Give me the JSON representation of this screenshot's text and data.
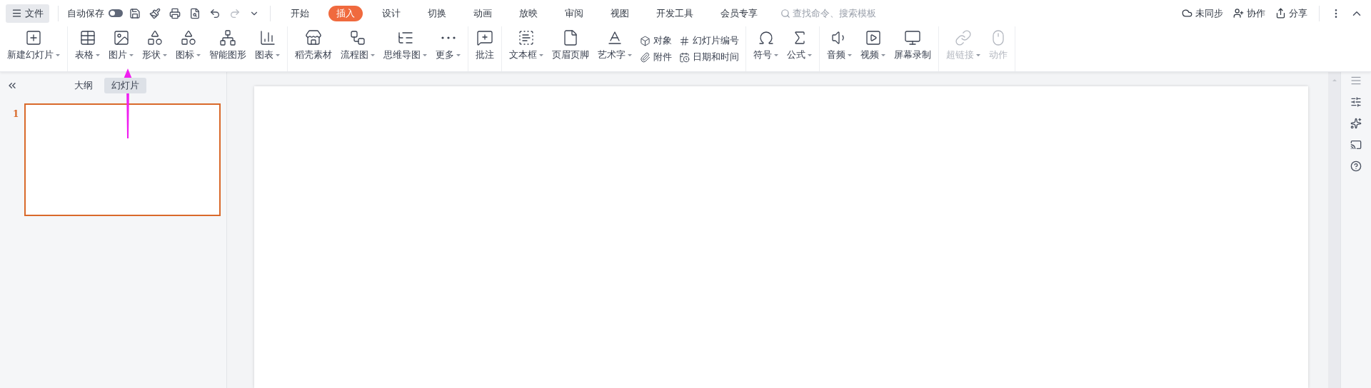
{
  "file_menu": {
    "label": "文件"
  },
  "autosave": {
    "label": "自动保存",
    "on": false
  },
  "tabs": [
    {
      "label": "开始",
      "selected": false
    },
    {
      "label": "插入",
      "selected": true
    },
    {
      "label": "设计",
      "selected": false
    },
    {
      "label": "切换",
      "selected": false
    },
    {
      "label": "动画",
      "selected": false
    },
    {
      "label": "放映",
      "selected": false
    },
    {
      "label": "审阅",
      "selected": false
    },
    {
      "label": "视图",
      "selected": false
    },
    {
      "label": "开发工具",
      "selected": false
    },
    {
      "label": "会员专享",
      "selected": false
    }
  ],
  "search": {
    "placeholder": "查找命令、搜索模板"
  },
  "top_actions": [
    {
      "label": "未同步"
    },
    {
      "label": "协作"
    },
    {
      "label": "分享"
    }
  ],
  "ribbon_groups": [
    {
      "items": [
        {
          "kind": "large",
          "label": "新建幻灯片",
          "dropdown": true,
          "disabled": false
        }
      ]
    },
    {
      "items": [
        {
          "kind": "large",
          "label": "表格",
          "dropdown": true,
          "disabled": false
        },
        {
          "kind": "large",
          "label": "图片",
          "dropdown": true,
          "disabled": false
        },
        {
          "kind": "large",
          "label": "形状",
          "dropdown": true,
          "disabled": false
        },
        {
          "kind": "large",
          "label": "图标",
          "dropdown": true,
          "disabled": false
        },
        {
          "kind": "large",
          "label": "智能图形",
          "dropdown": false,
          "disabled": false
        },
        {
          "kind": "large",
          "label": "图表",
          "dropdown": true,
          "disabled": false
        }
      ]
    },
    {
      "items": [
        {
          "kind": "large",
          "label": "稻壳素材",
          "dropdown": false,
          "disabled": false
        },
        {
          "kind": "large",
          "label": "流程图",
          "dropdown": true,
          "disabled": false
        },
        {
          "kind": "large",
          "label": "思维导图",
          "dropdown": true,
          "disabled": false
        },
        {
          "kind": "large",
          "label": "更多",
          "dropdown": true,
          "disabled": false
        }
      ]
    },
    {
      "items": [
        {
          "kind": "large",
          "label": "批注",
          "dropdown": false,
          "disabled": false
        }
      ]
    },
    {
      "items": [
        {
          "kind": "large",
          "label": "文本框",
          "dropdown": true,
          "disabled": false
        },
        {
          "kind": "large",
          "label": "页眉页脚",
          "dropdown": false,
          "disabled": false
        },
        {
          "kind": "large",
          "label": "艺术字",
          "dropdown": true,
          "disabled": false
        },
        {
          "kind": "pair",
          "top": "对象",
          "bottom": "附件"
        },
        {
          "kind": "pair",
          "top": "幻灯片编号",
          "bottom": "日期和时间"
        }
      ]
    },
    {
      "items": [
        {
          "kind": "large",
          "label": "符号",
          "dropdown": true,
          "disabled": false
        },
        {
          "kind": "large",
          "label": "公式",
          "dropdown": true,
          "disabled": false
        }
      ]
    },
    {
      "items": [
        {
          "kind": "large",
          "label": "音频",
          "dropdown": true,
          "disabled": false
        },
        {
          "kind": "large",
          "label": "视频",
          "dropdown": true,
          "disabled": false
        },
        {
          "kind": "large",
          "label": "屏幕录制",
          "dropdown": false,
          "disabled": false
        }
      ]
    },
    {
      "items": [
        {
          "kind": "large",
          "label": "超链接",
          "dropdown": true,
          "disabled": true
        },
        {
          "kind": "large",
          "label": "动作",
          "dropdown": false,
          "disabled": true
        }
      ]
    }
  ],
  "side_panel": {
    "tabs": [
      {
        "label": "大纲",
        "selected": false
      },
      {
        "label": "幻灯片",
        "selected": true
      }
    ],
    "slides": [
      {
        "number": "1",
        "selected": true
      }
    ]
  }
}
